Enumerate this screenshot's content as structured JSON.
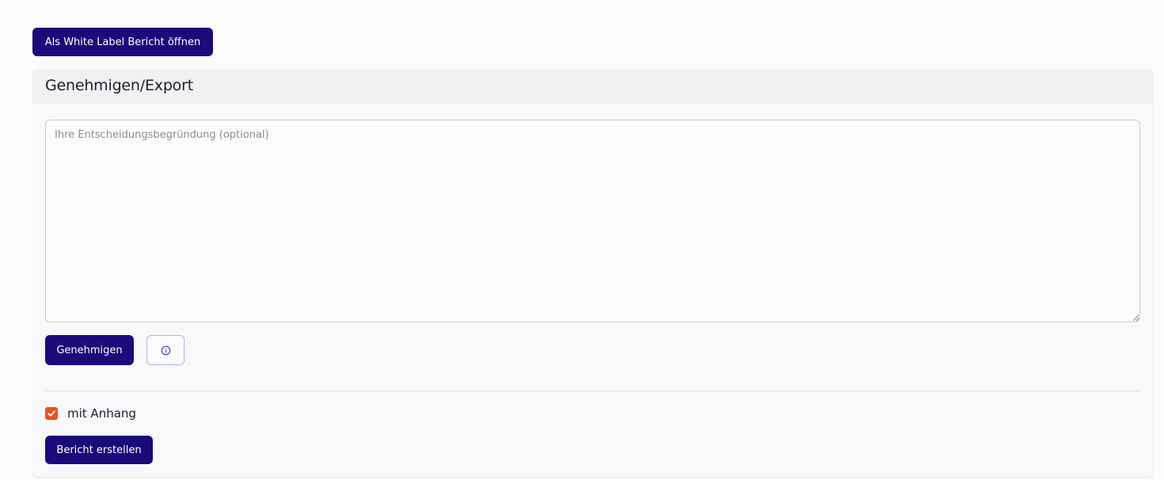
{
  "top_bar": {
    "white_label_button": "Als White Label Bericht öffnen"
  },
  "approval_card": {
    "title": "Genehmigen/Export",
    "reason_field": {
      "placeholder": "Ihre Entscheidungsbegründung (optional)",
      "value": ""
    },
    "approve_button": "Genehmigen",
    "info_button_icon": "info-circle-icon",
    "attachment_checkbox": {
      "label": "mit Anhang",
      "checked": true
    },
    "create_report_button": "Bericht erstellen"
  },
  "colors": {
    "primary_button": "#1b0a7a",
    "checkbox_accent": "#e8521f",
    "info_button_border": "#a9b4ea",
    "page_background": "#fbfbfc",
    "card_header_background": "#f1f1f3"
  }
}
